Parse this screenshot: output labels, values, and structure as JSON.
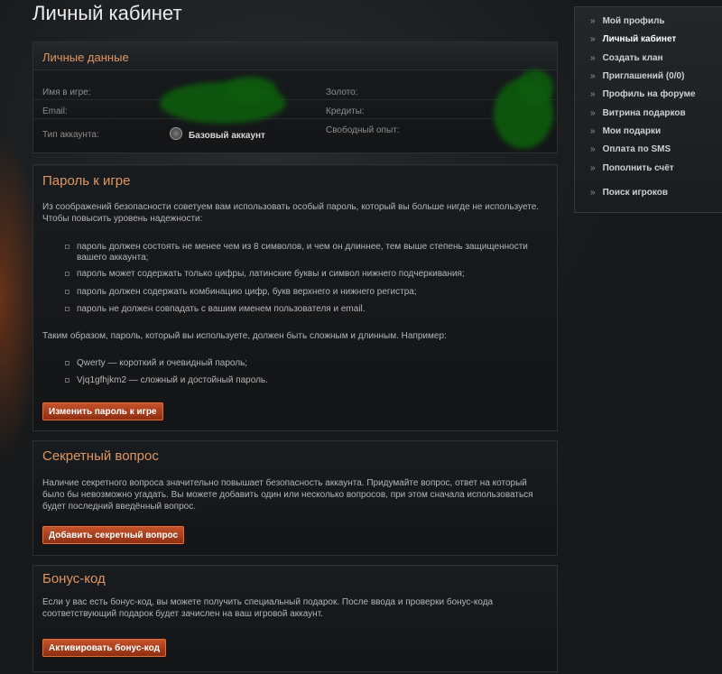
{
  "page": {
    "title": "Личный кабинет"
  },
  "personal": {
    "title": "Личные данные",
    "labels": {
      "nickname": "Имя в игре:",
      "email": "Email:",
      "account_type": "Тип аккаунта:",
      "gold": "Золото:",
      "credits": "Кредиты:",
      "free_xp": "Свободный опыт:"
    },
    "account_type_value": "Базовый аккаунт",
    "account_type_icon": "medal-icon"
  },
  "password": {
    "title": "Пароль к игре",
    "intro": "Из соображений безопасности советуем вам использовать особый пароль, который вы больше нигде не используете. Чтобы повысить уровень надежности:",
    "rules": [
      "пароль должен состоять не менее чем из 8 символов, и чем он длиннее, тем выше степень защищенности вашего аккаунта;",
      "пароль может содержать только цифры, латинские буквы и символ нижнего подчеркивания;",
      "пароль должен содержать комбинацию цифр, букв верхнего и нижнего регистра;",
      "пароль не должен совпадать с вашим именем пользователя и email."
    ],
    "summary": "Таким образом, пароль, который вы используете, должен быть сложным и длинным. Например:",
    "examples": [
      "Qwerty — короткий и очевидный пароль;",
      "Vjq1gfhjkm2 — сложный и достойный пароль."
    ],
    "button": "Изменить пароль к игре"
  },
  "secret": {
    "title": "Секретный вопрос",
    "text": "Наличие секретного вопроса значительно повышает безопасность аккаунта. Придумайте вопрос, ответ на который было бы невозможно угадать. Вы можете добавить один или несколько вопросов, при этом сначала использоваться будет последний введённый вопрос.",
    "button": "Добавить секретный вопрос"
  },
  "bonus": {
    "title": "Бонус-код",
    "text": "Если у вас есть бонус-код, вы можете получить специальный подарок. После ввода и проверки бонус-кода соответствующий подарок будет зачислен на ваш игровой аккаунт.",
    "button": "Активировать бонус-код"
  },
  "menu": {
    "arrow": "»",
    "items": [
      "Мой профиль",
      "Личный кабинет",
      "Создать клан",
      "Приглашений (0/0)",
      "Профиль на форуме",
      "Витрина подарков",
      "Мои подарки",
      "Оплата по SMS",
      "Пополнить счёт",
      "Поиск игроков"
    ],
    "active_index": 1
  },
  "colors": {
    "accent": "#e09560",
    "button": "#b0441f",
    "redaction": "#0d5a0d"
  }
}
